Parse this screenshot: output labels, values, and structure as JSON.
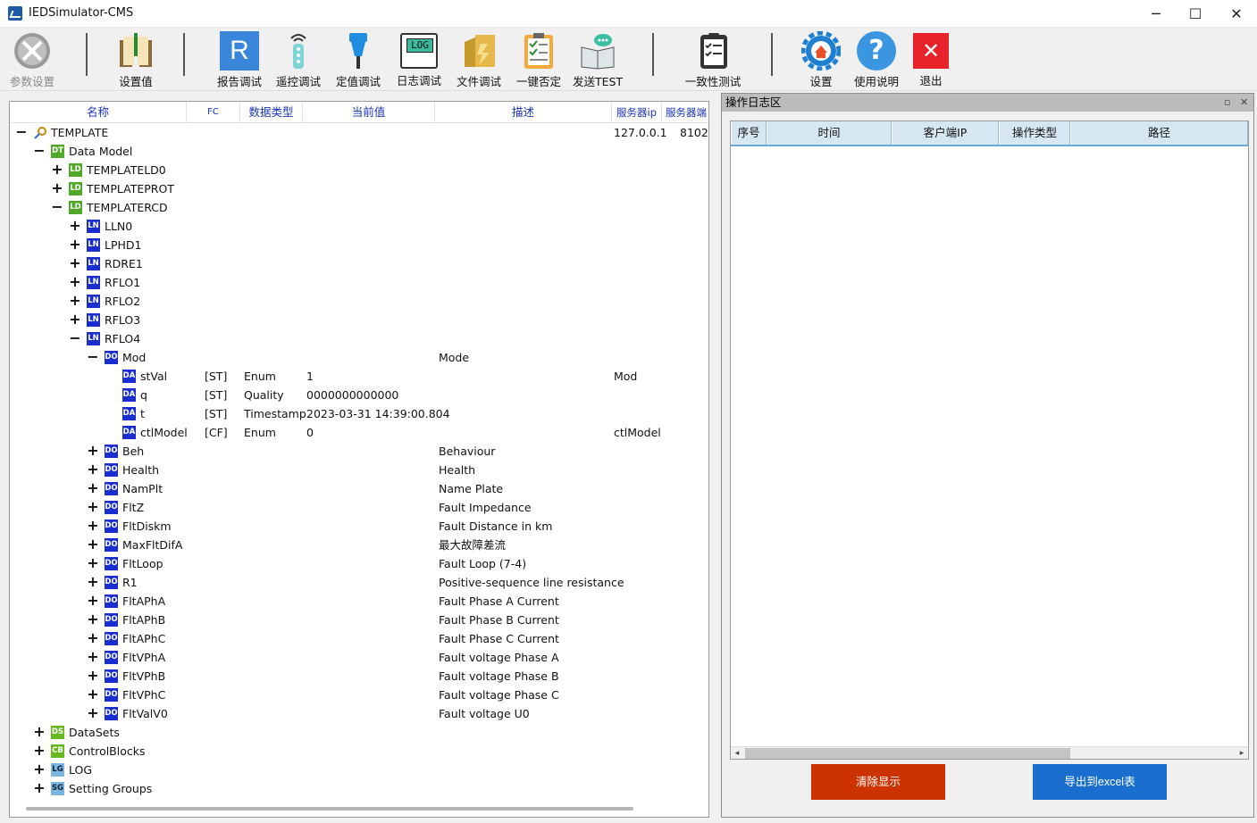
{
  "app": {
    "title": "IEDSimulator-CMS",
    "minimize": "─",
    "maximize": "☐",
    "close": "✕"
  },
  "toolbar": {
    "param_settings": "参数设置",
    "setpoint_value": "设置值",
    "report_debug": "报告调试",
    "remote_control": "遥控调试",
    "setting_debug": "定值调试",
    "log_debug": "日志调试",
    "file_debug": "文件调试",
    "one_key_negate": "一键否定",
    "send_test": "发送TEST",
    "consistency_test": "一致性测试",
    "settings": "设置",
    "help": "使用说明",
    "exit": "退出",
    "r_glyph": "R",
    "log_glyph": "LOG",
    "exit_glyph": "✕",
    "help_glyph": "?"
  },
  "tree": {
    "columns": [
      "名称",
      "FC",
      "数据类型",
      "当前值",
      "描述",
      "服务器ip",
      "服务器端"
    ],
    "rows": [
      {
        "depth": 0,
        "toggle": "−",
        "badge": "",
        "icon": "key",
        "name": "TEMPLATE",
        "ip": "127.0.0.1",
        "port": "8102"
      },
      {
        "depth": 1,
        "toggle": "−",
        "badge": "DT",
        "name": "Data Model"
      },
      {
        "depth": 2,
        "toggle": "+",
        "badge": "LD",
        "name": "TEMPLATELD0"
      },
      {
        "depth": 2,
        "toggle": "+",
        "badge": "LD",
        "name": "TEMPLATEPROT"
      },
      {
        "depth": 2,
        "toggle": "−",
        "badge": "LD",
        "name": "TEMPLATERCD"
      },
      {
        "depth": 3,
        "toggle": "+",
        "badge": "LN",
        "name": "LLN0"
      },
      {
        "depth": 3,
        "toggle": "+",
        "badge": "LN",
        "name": "LPHD1"
      },
      {
        "depth": 3,
        "toggle": "+",
        "badge": "LN",
        "name": "RDRE1"
      },
      {
        "depth": 3,
        "toggle": "+",
        "badge": "LN",
        "name": "RFLO1"
      },
      {
        "depth": 3,
        "toggle": "+",
        "badge": "LN",
        "name": "RFLO2"
      },
      {
        "depth": 3,
        "toggle": "+",
        "badge": "LN",
        "name": "RFLO3"
      },
      {
        "depth": 3,
        "toggle": "−",
        "badge": "LN",
        "name": "RFLO4"
      },
      {
        "depth": 4,
        "toggle": "−",
        "badge": "DO",
        "name": "Mod",
        "desc": "Mode"
      },
      {
        "depth": 5,
        "toggle": "",
        "badge": "DA",
        "name": "stVal",
        "fc": "[ST]",
        "type": "Enum",
        "value": "1",
        "ip": "Mod"
      },
      {
        "depth": 5,
        "toggle": "",
        "badge": "DA",
        "name": "q",
        "fc": "[ST]",
        "type": "Quality",
        "value": "0000000000000"
      },
      {
        "depth": 5,
        "toggle": "",
        "badge": "DA",
        "name": "t",
        "fc": "[ST]",
        "type": "Timestamp",
        "value": "2023-03-31 14:39:00.804"
      },
      {
        "depth": 5,
        "toggle": "",
        "badge": "DA",
        "name": "ctlModel",
        "fc": "[CF]",
        "type": "Enum",
        "value": "0",
        "ip": "ctlModel"
      },
      {
        "depth": 4,
        "toggle": "+",
        "badge": "DO",
        "name": "Beh",
        "desc": "Behaviour"
      },
      {
        "depth": 4,
        "toggle": "+",
        "badge": "DO",
        "name": "Health",
        "desc": "Health"
      },
      {
        "depth": 4,
        "toggle": "+",
        "badge": "DO",
        "name": "NamPlt",
        "desc": "Name Plate"
      },
      {
        "depth": 4,
        "toggle": "+",
        "badge": "DO",
        "name": "FltZ",
        "desc": "Fault Impedance"
      },
      {
        "depth": 4,
        "toggle": "+",
        "badge": "DO",
        "name": "FltDiskm",
        "desc": "Fault Distance in km"
      },
      {
        "depth": 4,
        "toggle": "+",
        "badge": "DO",
        "name": "MaxFltDifA",
        "desc": "最大故障差流"
      },
      {
        "depth": 4,
        "toggle": "+",
        "badge": "DO",
        "name": "FltLoop",
        "desc": "Fault Loop (7-4)"
      },
      {
        "depth": 4,
        "toggle": "+",
        "badge": "DO",
        "name": "R1",
        "desc": "Positive-sequence line resistance"
      },
      {
        "depth": 4,
        "toggle": "+",
        "badge": "DO",
        "name": "FltAPhA",
        "desc": "Fault Phase A Current"
      },
      {
        "depth": 4,
        "toggle": "+",
        "badge": "DO",
        "name": "FltAPhB",
        "desc": "Fault Phase B Current"
      },
      {
        "depth": 4,
        "toggle": "+",
        "badge": "DO",
        "name": "FltAPhC",
        "desc": "Fault Phase C Current"
      },
      {
        "depth": 4,
        "toggle": "+",
        "badge": "DO",
        "name": "FltVPhA",
        "desc": "Fault voltage Phase A"
      },
      {
        "depth": 4,
        "toggle": "+",
        "badge": "DO",
        "name": "FltVPhB",
        "desc": "Fault voltage Phase B"
      },
      {
        "depth": 4,
        "toggle": "+",
        "badge": "DO",
        "name": "FltVPhC",
        "desc": "Fault voltage Phase C"
      },
      {
        "depth": 4,
        "toggle": "+",
        "badge": "DO",
        "name": "FltValV0",
        "desc": "Fault voltage U0"
      },
      {
        "depth": 1,
        "toggle": "+",
        "badge": "DS",
        "name": "DataSets"
      },
      {
        "depth": 1,
        "toggle": "+",
        "badge": "CB",
        "name": "ControlBlocks"
      },
      {
        "depth": 1,
        "toggle": "+",
        "badge": "LG",
        "name": "LOG"
      },
      {
        "depth": 1,
        "toggle": "+",
        "badge": "SG",
        "name": "Setting Groups"
      }
    ]
  },
  "log_panel": {
    "title": "操作日志区",
    "pin": "▫",
    "close": "✕",
    "columns": [
      "序号",
      "时间",
      "客户端IP",
      "操作类型",
      "路径"
    ],
    "scroll_left": "◂",
    "scroll_right": "▸",
    "clear_button": "清除显示",
    "export_button": "导出到excel表"
  },
  "colors": {
    "badge_green": "#50a828",
    "badge_blue": "#1a2ed0",
    "header_text": "#1733b8",
    "clear": "#cc3300",
    "export": "#1a6fce"
  }
}
